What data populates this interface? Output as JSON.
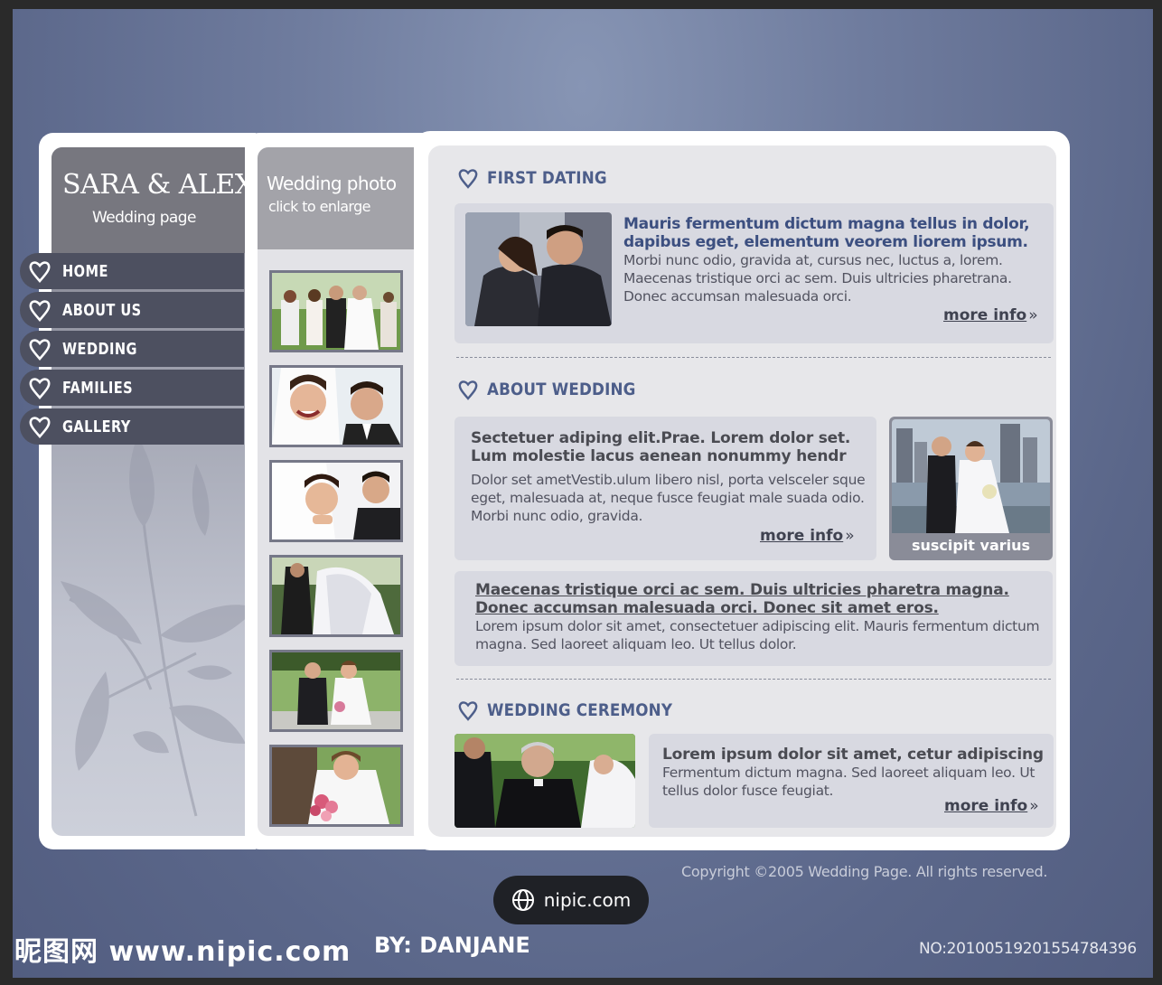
{
  "site": {
    "title": "SARA & ALEX",
    "subtitle": "Wedding page"
  },
  "nav": {
    "items": [
      {
        "label": "HOME"
      },
      {
        "label": "ABOUT US"
      },
      {
        "label": "WEDDING"
      },
      {
        "label": "FAMILIES"
      },
      {
        "label": "GALLERY"
      }
    ]
  },
  "photos": {
    "title": "Wedding photo",
    "subtitle": "click to enlarge",
    "thumbnail_count": 6
  },
  "sections": {
    "first_dating": {
      "title": "FIRST DATING",
      "lead": "Mauris fermentum dictum magna tellus in dolor, dapibus eget, elementum veorem liorem ipsum.",
      "body": "Morbi nunc odio, gravida at, cursus nec, luctus a, lorem. Maecenas tristique orci ac sem. Duis ultricies pharetrana. Donec accumsan malesuada orci.",
      "more": "more info",
      "more_arrow": "»"
    },
    "about_wedding": {
      "title": "ABOUT WEDDING",
      "lead": "Sectetuer adiping elit.Prae. Lorem dolor set. Lum molestie lacus aenean nonummy hendr",
      "body": "Dolor set ametVestib.ulum libero nisl, porta velsceler sque eget, malesuada at, neque fusce feugiat male suada odio. Morbi nunc odio, gravida.",
      "more": "more info",
      "more_arrow": "»",
      "photo_caption": "suscipit varius",
      "link_text": "Maecenas tristique orci ac sem. Duis ultricies  pharetra magna. Donec accumsan malesuada orci. Donec sit amet eros.",
      "link_body": "Lorem ipsum dolor sit amet, consectetuer adipiscing elit. Mauris fermentum dictum magna. Sed laoreet aliquam leo. Ut tellus dolor."
    },
    "wedding_ceremony": {
      "title": "WEDDING CEREMONY",
      "lead": "Lorem ipsum dolor sit amet, cetur adipiscing",
      "body": "Fermentum dictum magna. Sed laoreet aliquam leo. Ut tellus dolor fusce feugiat.",
      "more": "more info",
      "more_arrow": "»"
    }
  },
  "footer": {
    "copyright": "Copyright ©2005 Wedding Page. All rights reserved."
  },
  "watermark": {
    "pill_text": "nipic.com",
    "site": "昵图网 www.nipic.com",
    "by": "BY: DANJANE",
    "number": "NO:20100519201554784396"
  },
  "colors": {
    "accent": "#4d5e8a",
    "nav_bg": "#4d5060",
    "background": "#6f7c9e"
  }
}
